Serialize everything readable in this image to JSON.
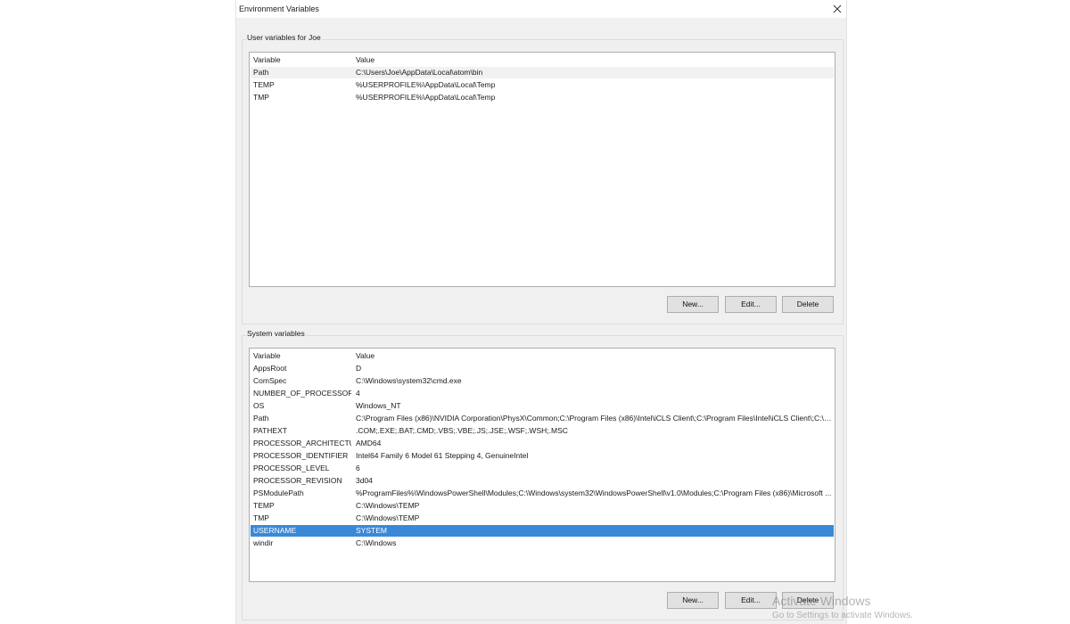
{
  "window": {
    "title": "Environment Variables"
  },
  "user_vars": {
    "group_label": "User variables for Joe",
    "headers": {
      "variable": "Variable",
      "value": "Value"
    },
    "rows": [
      {
        "variable": "Path",
        "value": "C:\\Users\\Joe\\AppData\\Local\\atom\\bin"
      },
      {
        "variable": "TEMP",
        "value": "%USERPROFILE%\\AppData\\Local\\Temp"
      },
      {
        "variable": "TMP",
        "value": "%USERPROFILE%\\AppData\\Local\\Temp"
      }
    ],
    "buttons": {
      "new": "New...",
      "edit": "Edit...",
      "delete": "Delete"
    }
  },
  "system_vars": {
    "group_label": "System variables",
    "headers": {
      "variable": "Variable",
      "value": "Value"
    },
    "rows": [
      {
        "variable": "AppsRoot",
        "value": "D"
      },
      {
        "variable": "ComSpec",
        "value": "C:\\Windows\\system32\\cmd.exe"
      },
      {
        "variable": "NUMBER_OF_PROCESSORS",
        "value": "4"
      },
      {
        "variable": "OS",
        "value": "Windows_NT"
      },
      {
        "variable": "Path",
        "value": "C:\\Program Files (x86)\\NVIDIA Corporation\\PhysX\\Common;C:\\Program Files (x86)\\Intel\\iCLS Client\\;C:\\Program Files\\Intel\\iCLS Client\\;C:\\Wi..."
      },
      {
        "variable": "PATHEXT",
        "value": ".COM;.EXE;.BAT;.CMD;.VBS;.VBE;.JS;.JSE;.WSF;.WSH;.MSC"
      },
      {
        "variable": "PROCESSOR_ARCHITECTURE",
        "value": "AMD64"
      },
      {
        "variable": "PROCESSOR_IDENTIFIER",
        "value": "Intel64 Family 6 Model 61 Stepping 4, GenuineIntel"
      },
      {
        "variable": "PROCESSOR_LEVEL",
        "value": "6"
      },
      {
        "variable": "PROCESSOR_REVISION",
        "value": "3d04"
      },
      {
        "variable": "PSModulePath",
        "value": "%ProgramFiles%\\WindowsPowerShell\\Modules;C:\\Windows\\system32\\WindowsPowerShell\\v1.0\\Modules;C:\\Program Files (x86)\\Microsoft ..."
      },
      {
        "variable": "TEMP",
        "value": "C:\\Windows\\TEMP"
      },
      {
        "variable": "TMP",
        "value": "C:\\Windows\\TEMP"
      },
      {
        "variable": "USERNAME",
        "value": "SYSTEM"
      },
      {
        "variable": "windir",
        "value": "C:\\Windows"
      }
    ],
    "selected_variable": "USERNAME",
    "buttons": {
      "new": "New...",
      "edit": "Edit...",
      "delete": "Delete"
    }
  },
  "watermark": {
    "line1": "Activate Windows",
    "line2": "Go to Settings to activate Windows."
  },
  "colors": {
    "selection": "#3a89d8",
    "dialog_bg": "#f0f0f0"
  },
  "icons": {
    "close": "close-icon"
  }
}
